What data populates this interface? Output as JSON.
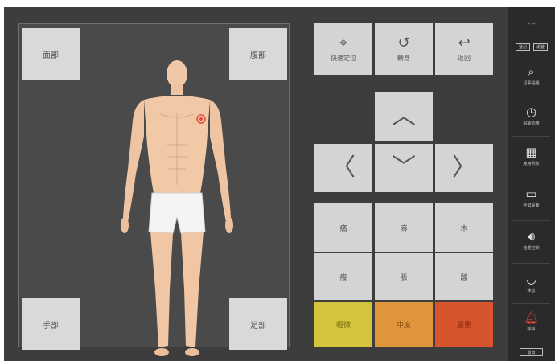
{
  "body_panel": {
    "face": "面部",
    "abdomen": "腹部",
    "hand": "手部",
    "foot": "足部"
  },
  "controls": {
    "quick_locate": "快速定位",
    "turn": "轉身",
    "back": "返回"
  },
  "symptoms": [
    "痛",
    "麻",
    "木",
    "癢",
    "脹",
    "酸"
  ],
  "levels": [
    {
      "label": "輕微",
      "color": "#d4c43b"
    },
    {
      "label": "中度",
      "color": "#e0963a"
    },
    {
      "label": "嚴重",
      "color": "#d8542d"
    }
  ],
  "sidebar": {
    "top_text": "– –",
    "mini_buttons": [
      "登記",
      "退登"
    ],
    "items": [
      {
        "label": "記事提醒",
        "icon": "search-clock-icon"
      },
      {
        "label": "點擊延時",
        "icon": "clock-icon"
      },
      {
        "label": "應用列表",
        "icon": "grid-icon"
      },
      {
        "label": "全屏桌面",
        "icon": "monitor-icon"
      },
      {
        "label": "音量控制",
        "icon": "speaker-icon"
      },
      {
        "label": "休息",
        "icon": "closed-eye-icon"
      },
      {
        "label": "呼叫",
        "icon": "bell-icon"
      }
    ],
    "exit": "退出"
  }
}
